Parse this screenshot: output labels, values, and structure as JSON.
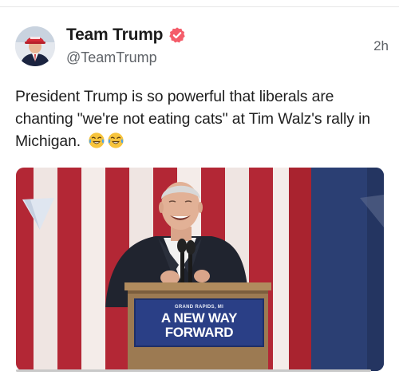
{
  "post": {
    "author": {
      "display_name": "Team Trump",
      "handle": "@TeamTrump",
      "verified": true,
      "verified_badge_color": "#f45d6a",
      "avatar_icon": "avatar-photo"
    },
    "timestamp": "2h",
    "body_text": "President Trump is so powerful that liberals are chanting \"we're not eating cats\" at Tim Walz's rally in Michigan.",
    "body_emojis": [
      "face-with-tears-of-joy",
      "face-with-tears-of-joy"
    ],
    "media": {
      "type": "photo",
      "podium_sign": {
        "location": "GRAND RAPIDS, MI",
        "line1": "A NEW WAY",
        "line2": "FORWARD"
      }
    }
  },
  "colors": {
    "text_primary": "#1f1f1f",
    "text_secondary": "#5f6368",
    "flag_red": "#b32735",
    "flag_blue": "#2b3f73",
    "sign_blue": "#2a3f86"
  }
}
